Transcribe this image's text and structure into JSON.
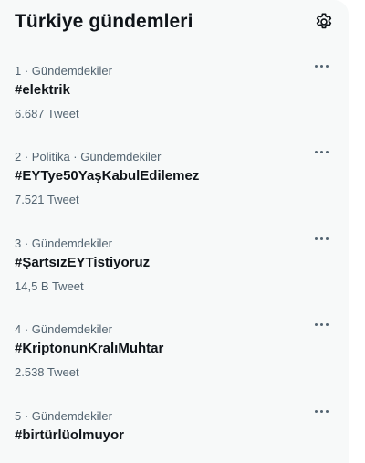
{
  "panel": {
    "title": "Türkiye gündemleri",
    "settings_icon": "gear-icon"
  },
  "trends": [
    {
      "meta": "1 · Gündemdekiler",
      "name": "#elektrik",
      "count": "6.687 Tweet"
    },
    {
      "meta": "2 · Politika · Gündemdekiler",
      "name": "#EYTye50YaşKabulEdilemez",
      "count": "7.521 Tweet"
    },
    {
      "meta": "3 · Gündemdekiler",
      "name": "#ŞartsızEYTistiyoruz",
      "count": "14,5 B Tweet"
    },
    {
      "meta": "4 · Gündemdekiler",
      "name": "#KriptonunKralıMuhtar",
      "count": "2.538 Tweet"
    },
    {
      "meta": "5 · Gündemdekiler",
      "name": "#birtürlüolmuyor",
      "count": ""
    }
  ],
  "more_icon": "more-horizontal-icon"
}
